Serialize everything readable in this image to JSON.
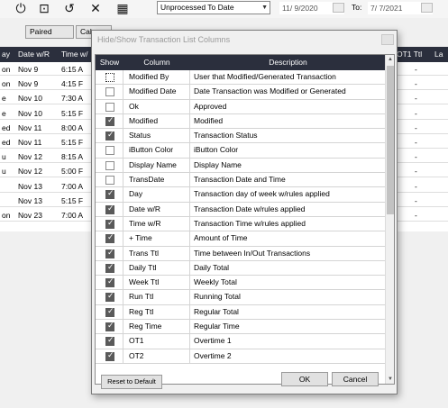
{
  "toolbar": {
    "icons": [
      "power-icon",
      "new-item-icon",
      "edit-icon",
      "close-icon",
      "calculator-icon"
    ],
    "filter_value": "Unprocessed To Date",
    "from_date": "11/ 9/2020",
    "to_label": "To:",
    "to_date": "7/ 7/2021"
  },
  "tabs": [
    "Paired",
    "Cale"
  ],
  "background_table": {
    "headers": [
      "ay",
      "Date w/R",
      "Time w/",
      "OT1 Ttl",
      "La"
    ],
    "rows": [
      {
        "day": "on",
        "date": "Nov 9",
        "time": "6:15 A",
        "ot1": "-"
      },
      {
        "day": "on",
        "date": "Nov 9",
        "time": "4:15 F",
        "ot1": "-"
      },
      {
        "day": "e",
        "date": "Nov 10",
        "time": "7:30 A",
        "ot1": "-"
      },
      {
        "day": "e",
        "date": "Nov 10",
        "time": "5:15 F",
        "ot1": "-"
      },
      {
        "day": "ed",
        "date": "Nov 11",
        "time": "8:00 A",
        "ot1": "-"
      },
      {
        "day": "ed",
        "date": "Nov 11",
        "time": "5:15 F",
        "ot1": "-"
      },
      {
        "day": "u",
        "date": "Nov 12",
        "time": "8:15 A",
        "ot1": "-"
      },
      {
        "day": "u",
        "date": "Nov 12",
        "time": "5:00 F",
        "ot1": "-"
      },
      {
        "day": "",
        "date": "Nov 13",
        "time": "7:00 A",
        "ot1": "-"
      },
      {
        "day": "",
        "date": "Nov 13",
        "time": "5:15 F",
        "ot1": "-"
      },
      {
        "day": "on",
        "date": "Nov 23",
        "time": "7:00 A",
        "ot1": "-"
      }
    ]
  },
  "dialog": {
    "title": "Hide/Show Transaction List Columns",
    "headers": {
      "show": "Show",
      "column": "Column",
      "description": "Description"
    },
    "rows": [
      {
        "checked": false,
        "column": "Modified By",
        "description": "User that Modified/Generated Transaction",
        "selected": true
      },
      {
        "checked": false,
        "column": "Modified Date",
        "description": "Date Transaction was Modified or Generated"
      },
      {
        "checked": false,
        "column": "Ok",
        "description": "Approved"
      },
      {
        "checked": true,
        "column": "Modified",
        "description": "Modified"
      },
      {
        "checked": true,
        "column": "Status",
        "description": "Transaction Status"
      },
      {
        "checked": false,
        "column": "iButton Color",
        "description": "iButton Color"
      },
      {
        "checked": false,
        "column": "Display Name",
        "description": "Display Name"
      },
      {
        "checked": false,
        "column": "TransDate",
        "description": "Transaction Date and Time"
      },
      {
        "checked": true,
        "column": "Day",
        "description": "Transaction day of week w/rules applied"
      },
      {
        "checked": true,
        "column": "Date w/R",
        "description": "Transaction Date w/rules applied"
      },
      {
        "checked": true,
        "column": "Time w/R",
        "description": "Transaction Time w/rules applied"
      },
      {
        "checked": true,
        "column": "+ Time",
        "description": "Amount of Time"
      },
      {
        "checked": true,
        "column": "Trans Ttl",
        "description": "Time between In/Out Transactions"
      },
      {
        "checked": true,
        "column": "Daily Ttl",
        "description": "Daily Total"
      },
      {
        "checked": true,
        "column": "Week Ttl",
        "description": "Weekly Total"
      },
      {
        "checked": true,
        "column": "Run Ttl",
        "description": "Running Total"
      },
      {
        "checked": true,
        "column": "Reg Ttl",
        "description": "Regular Total"
      },
      {
        "checked": true,
        "column": "Reg Time",
        "description": "Regular Time"
      },
      {
        "checked": true,
        "column": "OT1",
        "description": "Overtime 1"
      },
      {
        "checked": true,
        "column": "OT2",
        "description": "Overtime 2"
      }
    ],
    "reset_label": "Reset to Default",
    "ok_label": "OK",
    "cancel_label": "Cancel"
  }
}
